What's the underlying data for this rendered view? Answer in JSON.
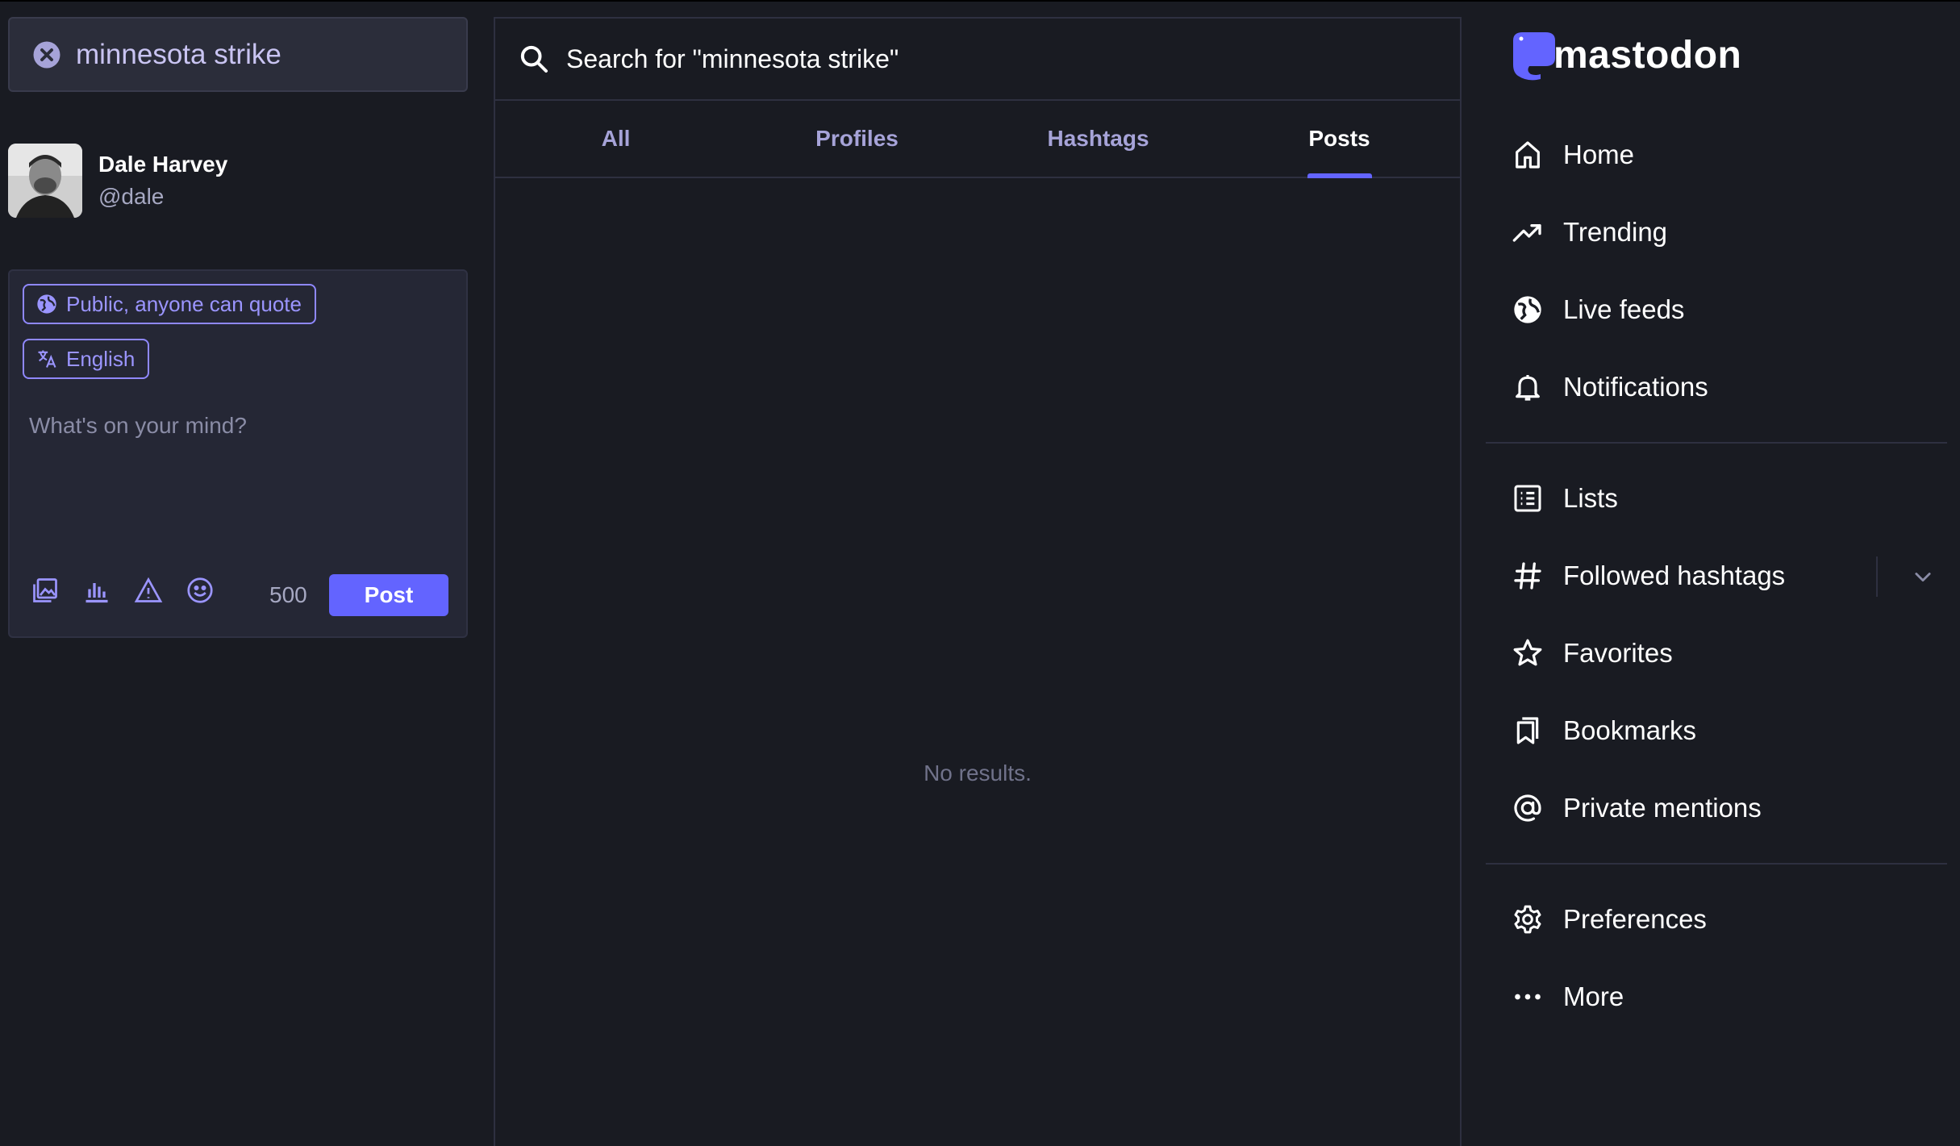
{
  "search": {
    "query": "minnesota strike"
  },
  "account": {
    "display_name": "Dale Harvey",
    "handle": "@dale"
  },
  "composer": {
    "visibility_label": "Public, anyone can quote",
    "language_label": "English",
    "placeholder": "What's on your mind?",
    "char_count": "500",
    "post_label": "Post",
    "tools": [
      "image-icon",
      "poll-icon",
      "warning-icon",
      "emoji-icon"
    ]
  },
  "results": {
    "header": "Search for \"minnesota strike\"",
    "tabs": [
      {
        "label": "All",
        "active": false
      },
      {
        "label": "Profiles",
        "active": false
      },
      {
        "label": "Hashtags",
        "active": false
      },
      {
        "label": "Posts",
        "active": true
      }
    ],
    "empty_message": "No results."
  },
  "nav": {
    "brand": "mastodon",
    "primary": [
      {
        "label": "Home",
        "icon": "home-icon"
      },
      {
        "label": "Trending",
        "icon": "trending-icon"
      },
      {
        "label": "Live feeds",
        "icon": "globe-icon"
      },
      {
        "label": "Notifications",
        "icon": "bell-icon"
      }
    ],
    "secondary": [
      {
        "label": "Lists",
        "icon": "list-icon"
      },
      {
        "label": "Followed hashtags",
        "icon": "hashtag-icon"
      },
      {
        "label": "Favorites",
        "icon": "star-icon"
      },
      {
        "label": "Bookmarks",
        "icon": "bookmark-icon"
      },
      {
        "label": "Private mentions",
        "icon": "at-icon"
      }
    ],
    "tertiary": [
      {
        "label": "Preferences",
        "icon": "gear-icon"
      },
      {
        "label": "More",
        "icon": "more-icon"
      }
    ]
  },
  "colors": {
    "accent": "#6364ff",
    "background": "#191b22",
    "panel": "#252735"
  }
}
